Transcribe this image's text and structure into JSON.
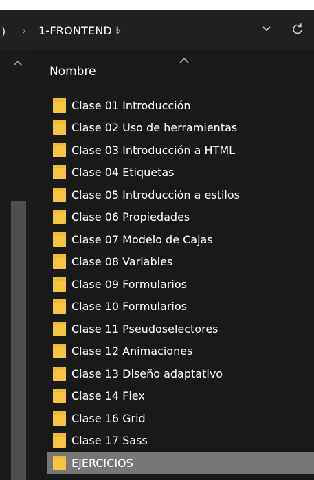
{
  "address_bar": {
    "left_fragment": ")",
    "separator": "›",
    "current_folder": "1-FRONTEND I",
    "trailing_separator": "›",
    "dropdown_icon": "chevron-down-icon",
    "refresh_icon": "refresh-icon"
  },
  "header": {
    "name_column": "Nombre",
    "sort_icon": "sort-ascending-icon"
  },
  "colors": {
    "folder_yellow": "#f6c445",
    "selection_gray": "#777777",
    "background": "#191919"
  },
  "files": [
    {
      "name": "Clase 01 Introducción",
      "type": "folder",
      "selected": false
    },
    {
      "name": "Clase 02 Uso de herramientas",
      "type": "folder",
      "selected": false
    },
    {
      "name": "Clase 03 Introducción a HTML",
      "type": "folder",
      "selected": false
    },
    {
      "name": "Clase 04 Etiquetas",
      "type": "folder",
      "selected": false
    },
    {
      "name": "Clase 05 Introducción a estilos",
      "type": "folder",
      "selected": false
    },
    {
      "name": "Clase 06 Propiedades",
      "type": "folder",
      "selected": false
    },
    {
      "name": "Clase 07 Modelo de Cajas",
      "type": "folder",
      "selected": false
    },
    {
      "name": "Clase 08 Variables",
      "type": "folder",
      "selected": false
    },
    {
      "name": "Clase 09 Formularios",
      "type": "folder",
      "selected": false
    },
    {
      "name": "Clase 10 Formularios",
      "type": "folder",
      "selected": false
    },
    {
      "name": "Clase 11 Pseudoselectores",
      "type": "folder",
      "selected": false
    },
    {
      "name": "Clase 12 Animaciones",
      "type": "folder",
      "selected": false
    },
    {
      "name": "Clase 13 Diseño adaptativo",
      "type": "folder",
      "selected": false
    },
    {
      "name": "Clase 14 Flex",
      "type": "folder",
      "selected": false
    },
    {
      "name": "Clase 16 Grid",
      "type": "folder",
      "selected": false
    },
    {
      "name": "Clase 17 Sass",
      "type": "folder",
      "selected": false
    },
    {
      "name": "EJERCICIOS",
      "type": "folder",
      "selected": true
    }
  ]
}
